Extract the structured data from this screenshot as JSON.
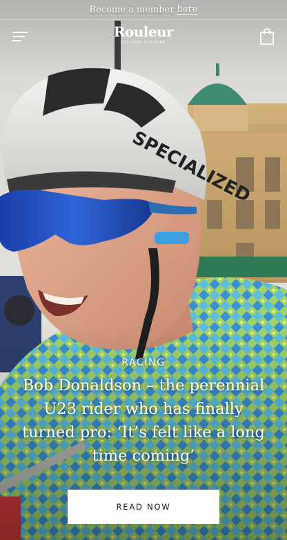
{
  "promo": {
    "text": "Become a member",
    "link_label": "here"
  },
  "header": {
    "logo_text": "Rouleur",
    "logo_tagline": "CYCLING CULTURE",
    "menu_icon": "hamburger-menu-icon",
    "bag_icon": "shopping-bag-icon"
  },
  "hero": {
    "category": "RACING",
    "headline": "Bob Donaldson – the perennial U23 rider who has finally turned pro: ‘It’s felt like a long time coming’",
    "cta_label": "READ NOW"
  },
  "colors": {
    "text": "#ffffff",
    "button_bg": "#ffffff",
    "button_text": "#1a1a1a"
  }
}
